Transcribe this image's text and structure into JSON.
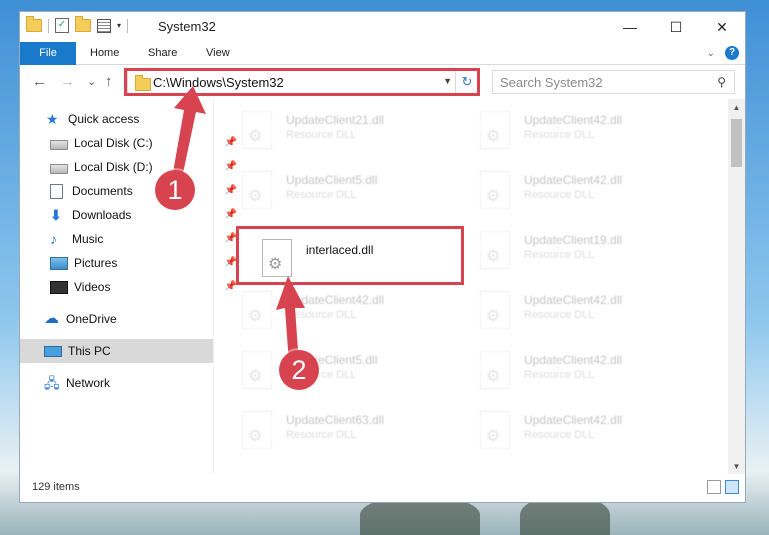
{
  "window": {
    "title": "System32",
    "controls": {
      "minimize": "—",
      "maximize": "☐",
      "close": "✕"
    }
  },
  "ribbon": {
    "tabs": [
      "File",
      "Home",
      "Share",
      "View"
    ]
  },
  "navigation": {
    "back": "←",
    "forward": "→",
    "recent": "⌄",
    "up": "↑",
    "address": "C:\\Windows\\System32",
    "search_placeholder": "Search System32"
  },
  "sidebar": {
    "items": [
      {
        "label": "Quick access",
        "icon": "star-icon",
        "pinned": false
      },
      {
        "label": "Local Disk (C:)",
        "icon": "disk-icon",
        "pinned": true
      },
      {
        "label": "Local Disk (D:)",
        "icon": "disk-icon",
        "pinned": true
      },
      {
        "label": "Documents",
        "icon": "documents-icon",
        "pinned": true
      },
      {
        "label": "Downloads",
        "icon": "downloads-icon",
        "pinned": true
      },
      {
        "label": "Music",
        "icon": "music-icon",
        "pinned": true
      },
      {
        "label": "Pictures",
        "icon": "pictures-icon",
        "pinned": true
      },
      {
        "label": "Videos",
        "icon": "videos-icon",
        "pinned": true
      },
      {
        "label": "OneDrive",
        "icon": "onedrive-icon",
        "pinned": false
      },
      {
        "label": "This PC",
        "icon": "this-pc-icon",
        "pinned": false,
        "selected": true
      },
      {
        "label": "Network",
        "icon": "network-icon",
        "pinned": false
      }
    ]
  },
  "files": [
    {
      "name": "UpdateClient21.dll",
      "type": "Resource DLL",
      "faded": true
    },
    {
      "name": "UpdateClient42.dll",
      "type": "Resource DLL",
      "faded": true
    },
    {
      "name": "UpdateClient5.dll",
      "type": "Resource DLL",
      "faded": true
    },
    {
      "name": "UpdateClient42.dll",
      "type": "Resource DLL",
      "faded": true
    },
    {
      "name": "interlaced.dll",
      "type": "",
      "faded": false
    },
    {
      "name": "UpdateClient19.dll",
      "type": "Resource DLL",
      "faded": true
    },
    {
      "name": "UpdateClient42.dll",
      "type": "Resource DLL",
      "faded": true
    },
    {
      "name": "UpdateClient42.dll",
      "type": "Resource DLL",
      "faded": true
    },
    {
      "name": "UpdateClient5.dll",
      "type": "Resource DLL",
      "faded": true
    },
    {
      "name": "UpdateClient42.dll",
      "type": "Resource DLL",
      "faded": true
    },
    {
      "name": "UpdateClient63.dll",
      "type": "Resource DLL",
      "faded": true
    },
    {
      "name": "UpdateClient42.dll",
      "type": "Resource DLL",
      "faded": true
    }
  ],
  "status": {
    "item_count": "129 items"
  },
  "annotations": {
    "step1": "1",
    "step2": "2",
    "color": "#d7434f"
  }
}
